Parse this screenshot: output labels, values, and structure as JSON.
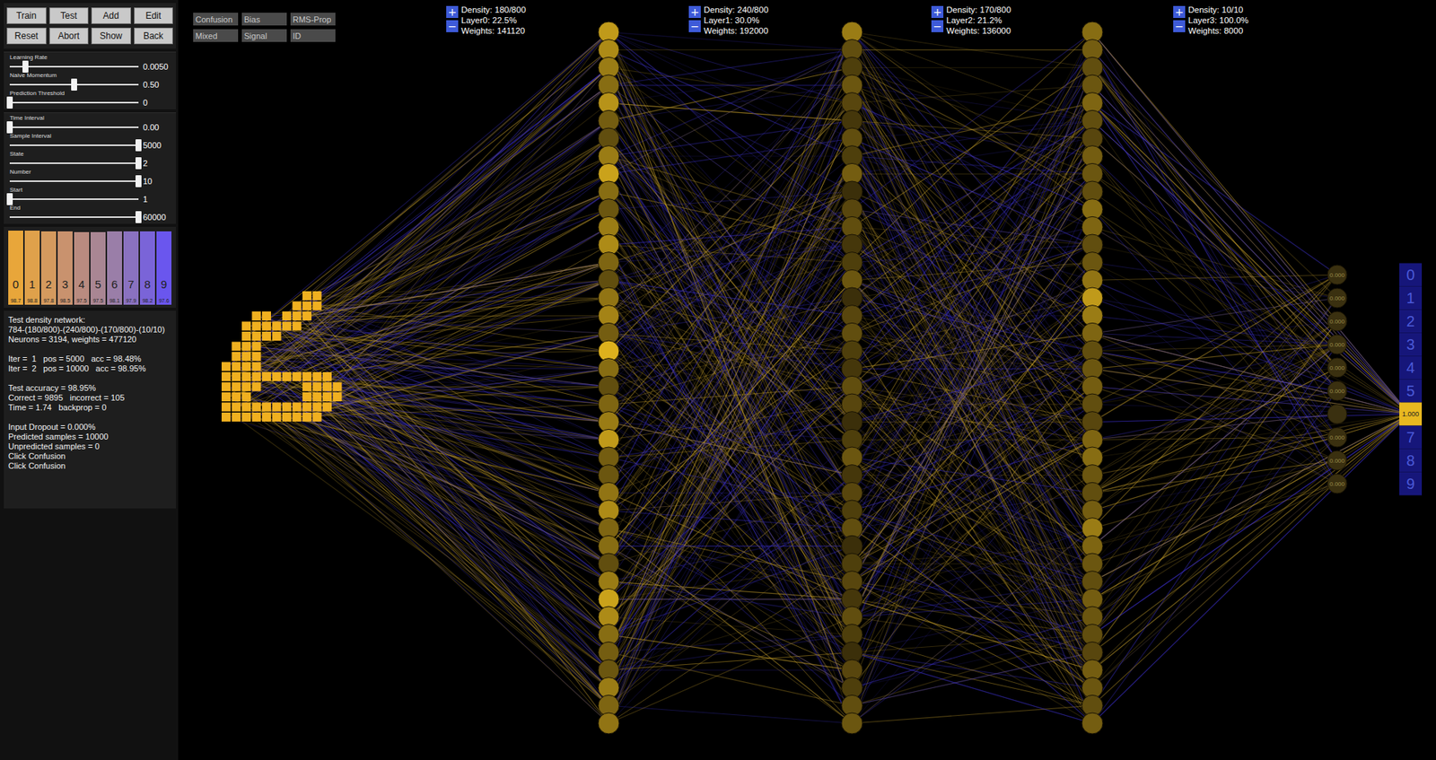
{
  "buttons": [
    {
      "label": "Train"
    },
    {
      "label": "Test"
    },
    {
      "label": "Add"
    },
    {
      "label": "Edit"
    },
    {
      "label": "Reset"
    },
    {
      "label": "Abort"
    },
    {
      "label": "Show"
    },
    {
      "label": "Back"
    }
  ],
  "slider_groups": [
    [
      {
        "label": "Learning Rate",
        "value": "0.0050",
        "level": 0.12
      },
      {
        "label": "Naive Momentum",
        "value": "0.50",
        "level": 0.5
      },
      {
        "label": "Prediction Threshold",
        "value": "0",
        "level": 0.0
      }
    ],
    [
      {
        "label": "Time Interval",
        "value": "0.00",
        "level": 0.0
      },
      {
        "label": "Sample Interval",
        "value": "5000",
        "level": 1.0
      },
      {
        "label": "State",
        "value": "2",
        "level": 1.0
      },
      {
        "label": "Number",
        "value": "10",
        "level": 1.0
      },
      {
        "label": "Start",
        "value": "1",
        "level": 0.0
      },
      {
        "label": "End",
        "value": "60000",
        "level": 1.0
      }
    ]
  ],
  "class_accuracy": [
    {
      "label": "0",
      "value": "98.7",
      "level": 0.987,
      "color": "#e8a63a"
    },
    {
      "label": "1",
      "value": "98.8",
      "level": 0.988,
      "color": "#dfa14b"
    },
    {
      "label": "2",
      "value": "97.8",
      "level": 0.978,
      "color": "#d49a5e"
    },
    {
      "label": "3",
      "value": "98.5",
      "level": 0.985,
      "color": "#c9926e"
    },
    {
      "label": "4",
      "value": "97.5",
      "level": 0.975,
      "color": "#b98b80"
    },
    {
      "label": "5",
      "value": "97.5",
      "level": 0.975,
      "color": "#a98693"
    },
    {
      "label": "6",
      "value": "98.1",
      "level": 0.981,
      "color": "#9a7ea8"
    },
    {
      "label": "7",
      "value": "97.9",
      "level": 0.979,
      "color": "#8a72c0"
    },
    {
      "label": "8",
      "value": "98.2",
      "level": 0.982,
      "color": "#7a64d8"
    },
    {
      "label": "9",
      "value": "97.6",
      "level": 0.976,
      "color": "#6a56ee"
    }
  ],
  "log": [
    [
      "Test density network:",
      "784-(180/800)-(240/800)-(170/800)-(10/10)",
      "Neurons = 3194, weights = 477120"
    ],
    [
      "Iter =  1   pos = 5000   acc = 98.48%",
      "Iter =  2   pos = 10000   acc = 98.95%"
    ],
    [
      "Test accuracy = 98.95%",
      "Correct = 9895   incorrect = 105",
      "Time = 1.74   backprop = 0"
    ],
    [
      "Input Dropout = 0.000%",
      "Predicted samples = 10000",
      "Unpredicted samples = 0",
      "Click Confusion",
      "Click Confusion"
    ]
  ],
  "toggles": [
    {
      "label": "Confusion",
      "selected": false
    },
    {
      "label": "Bias",
      "selected": false
    },
    {
      "label": "RMS-Prop",
      "selected": false
    },
    {
      "label": "Mixed",
      "selected": false
    },
    {
      "label": "Signal",
      "selected": false
    },
    {
      "label": "ID",
      "selected": false
    }
  ],
  "layers": [
    {
      "density": "Density: 180/800",
      "share": "Layer0: 22.5%",
      "weights": "Weights: 141120",
      "plus": "+",
      "minus": "−"
    },
    {
      "density": "Density: 240/800",
      "share": "Layer1: 30.0%",
      "weights": "Weights: 192000",
      "plus": "+",
      "minus": "−"
    },
    {
      "density": "Density: 170/800",
      "share": "Layer2: 21.2%",
      "weights": "Weights: 136000",
      "plus": "+",
      "minus": "−"
    },
    {
      "density": "Density: 10/10",
      "share": "Layer3: 100.0%",
      "weights": "Weights: 8000",
      "plus": "+",
      "minus": "−"
    }
  ],
  "input": {
    "rows": [
      "........##..",
      ".......###..",
      "...##.###...",
      "..######....",
      "..####......",
      ".###........",
      ".###........",
      "####........",
      "###########.",
      "####....####",
      "###.....####",
      "###########.",
      "##########.."
    ]
  },
  "hidden_layers": [
    {
      "activations": [
        0.8,
        0.7,
        0.6,
        0.5,
        0.75,
        0.4,
        0.3,
        0.6,
        0.85,
        0.5,
        0.35,
        0.6,
        0.7,
        0.45,
        0.3,
        0.55,
        0.65,
        0.4,
        0.95,
        0.5,
        0.3,
        0.45,
        0.6,
        0.8,
        0.4,
        0.35,
        0.55,
        0.7,
        0.45,
        0.5,
        0.3,
        0.6,
        0.85,
        0.7,
        0.5,
        0.4,
        0.35,
        0.6,
        0.45,
        0.55
      ]
    },
    {
      "activations": [
        0.6,
        0.3,
        0.2,
        0.35,
        0.25,
        0.15,
        0.3,
        0.2,
        0.4,
        0.1,
        0.25,
        0.3,
        0.15,
        0.2,
        0.35,
        0.1,
        0.25,
        0.3,
        0.2,
        0.15,
        0.3,
        0.25,
        0.1,
        0.2,
        0.35,
        0.15,
        0.25,
        0.2,
        0.3,
        0.1,
        0.2,
        0.25,
        0.15,
        0.3,
        0.2,
        0.1,
        0.25,
        0.2,
        0.3,
        0.35
      ]
    },
    {
      "activations": [
        0.5,
        0.4,
        0.3,
        0.35,
        0.45,
        0.3,
        0.25,
        0.4,
        0.35,
        0.3,
        0.5,
        0.45,
        0.3,
        0.35,
        0.55,
        0.8,
        0.6,
        0.45,
        0.3,
        0.35,
        0.4,
        0.3,
        0.25,
        0.45,
        0.5,
        0.35,
        0.3,
        0.4,
        0.6,
        0.45,
        0.35,
        0.3,
        0.4,
        0.35,
        0.3,
        0.25,
        0.4,
        0.35,
        0.3,
        0.4
      ]
    }
  ],
  "outputs": [
    {
      "label": "0",
      "value": "0.000",
      "selected": false
    },
    {
      "label": "1",
      "value": "0.000",
      "selected": false
    },
    {
      "label": "2",
      "value": "0.000",
      "selected": false
    },
    {
      "label": "3",
      "value": "0.000",
      "selected": false
    },
    {
      "label": "4",
      "value": "0.000",
      "selected": false
    },
    {
      "label": "5",
      "value": "0.000",
      "selected": false
    },
    {
      "label": "6",
      "value": "1.000",
      "selected": true
    },
    {
      "label": "7",
      "value": "0.000",
      "selected": false
    },
    {
      "label": "8",
      "value": "0.000",
      "selected": false
    },
    {
      "label": "9",
      "value": "0.000",
      "selected": false
    }
  ]
}
